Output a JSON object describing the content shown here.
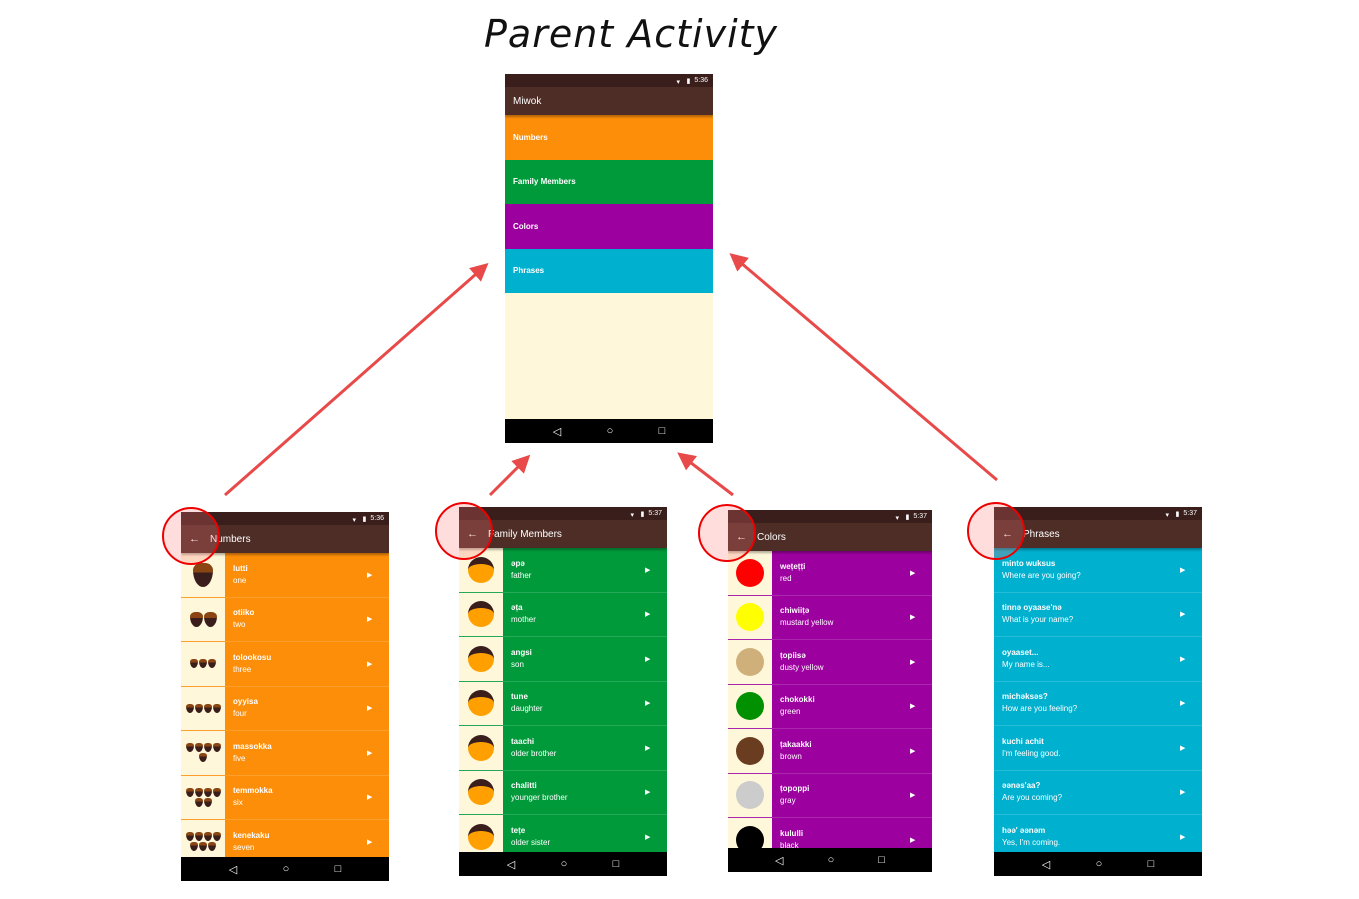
{
  "title": "Parent Activity",
  "parent": {
    "app_title": "Miwok",
    "time": "5:36",
    "categories": [
      {
        "label": "Numbers",
        "color": "#fd8e09"
      },
      {
        "label": "Family Members",
        "color": "#009a3a"
      },
      {
        "label": "Colors",
        "color": "#9c009f"
      },
      {
        "label": "Phrases",
        "color": "#00b0cf"
      }
    ]
  },
  "screens": [
    {
      "id": "numbers",
      "title": "Numbers",
      "time": "5:36",
      "color": "#fd8e09",
      "image": "acorn",
      "items": [
        {
          "miwok": "lutti",
          "english": "one",
          "count": 1
        },
        {
          "miwok": "otiiko",
          "english": "two",
          "count": 2
        },
        {
          "miwok": "tolookosu",
          "english": "three",
          "count": 3
        },
        {
          "miwok": "oyyisa",
          "english": "four",
          "count": 4
        },
        {
          "miwok": "massokka",
          "english": "five",
          "count": 5
        },
        {
          "miwok": "temmokka",
          "english": "six",
          "count": 6
        },
        {
          "miwok": "kenekaku",
          "english": "seven",
          "count": 7
        }
      ]
    },
    {
      "id": "family",
      "title": "Family Members",
      "time": "5:37",
      "color": "#009a3a",
      "image": "face",
      "items": [
        {
          "miwok": "əpə",
          "english": "father"
        },
        {
          "miwok": "əṭa",
          "english": "mother"
        },
        {
          "miwok": "angsi",
          "english": "son"
        },
        {
          "miwok": "tune",
          "english": "daughter"
        },
        {
          "miwok": "taachi",
          "english": "older brother"
        },
        {
          "miwok": "chalitti",
          "english": "younger brother"
        },
        {
          "miwok": "teṭe",
          "english": "older sister"
        }
      ]
    },
    {
      "id": "colors",
      "title": "Colors",
      "time": "5:37",
      "color": "#9c009f",
      "image": "swatch",
      "items": [
        {
          "miwok": "weṭeṭṭi",
          "english": "red",
          "swatch": "#ff0000"
        },
        {
          "miwok": "chiwiiṭә",
          "english": "mustard yellow",
          "swatch": "#ffff00"
        },
        {
          "miwok": "ṭopiisә",
          "english": "dusty yellow",
          "swatch": "#d0b07a"
        },
        {
          "miwok": "chokokki",
          "english": "green",
          "swatch": "#009000"
        },
        {
          "miwok": "ṭakaakki",
          "english": "brown",
          "swatch": "#6b3d20"
        },
        {
          "miwok": "ṭopoppi",
          "english": "gray",
          "swatch": "#cccccc"
        },
        {
          "miwok": "kululli",
          "english": "black",
          "swatch": "#000000"
        }
      ]
    },
    {
      "id": "phrases",
      "title": "Phrases",
      "time": "5:37",
      "color": "#00b0cf",
      "image": "none",
      "items": [
        {
          "miwok": "minto wuksus",
          "english": "Where are you going?"
        },
        {
          "miwok": "tinnә oyaase'nә",
          "english": "What is your name?"
        },
        {
          "miwok": "oyaaset...",
          "english": "My name is..."
        },
        {
          "miwok": "michәksәs?",
          "english": "How are you feeling?"
        },
        {
          "miwok": "kuchi achit",
          "english": "I'm feeling good."
        },
        {
          "miwok": "әәnәs'aa?",
          "english": "Are you coming?"
        },
        {
          "miwok": "hәә' әәnәm",
          "english": "Yes, I'm coming."
        }
      ]
    }
  ],
  "arrow_color": "#e84a4a"
}
